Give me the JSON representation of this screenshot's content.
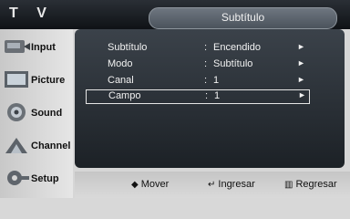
{
  "window": {
    "title": "T V"
  },
  "header": {
    "label": "Subtítulo"
  },
  "sidebar": {
    "items": [
      {
        "label": "Input",
        "icon": "input-icon"
      },
      {
        "label": "Picture",
        "icon": "picture-icon"
      },
      {
        "label": "Sound",
        "icon": "sound-icon"
      },
      {
        "label": "Channel",
        "icon": "channel-icon"
      },
      {
        "label": "Setup",
        "icon": "setup-icon"
      }
    ]
  },
  "menu": {
    "rows": [
      {
        "label": "Subtítulo",
        "value": "Encendido"
      },
      {
        "label": "Modo",
        "value": "Subtítulo"
      },
      {
        "label": "Canal",
        "value": "1"
      },
      {
        "label": "Campo",
        "value": "1"
      }
    ],
    "colon": ":",
    "arrow": "►",
    "selected_index": 3
  },
  "footer": {
    "move_label": "Mover",
    "enter_label": "Ingresar",
    "return_label": "Regresar",
    "move_glyph": "◆",
    "enter_glyph": "↵",
    "return_glyph": "▥"
  },
  "colors": {
    "panel": "#2a3037",
    "bar_dark": "#0f1216",
    "sidebar": "#d6d6d6",
    "text_light": "#f2f2f2"
  }
}
